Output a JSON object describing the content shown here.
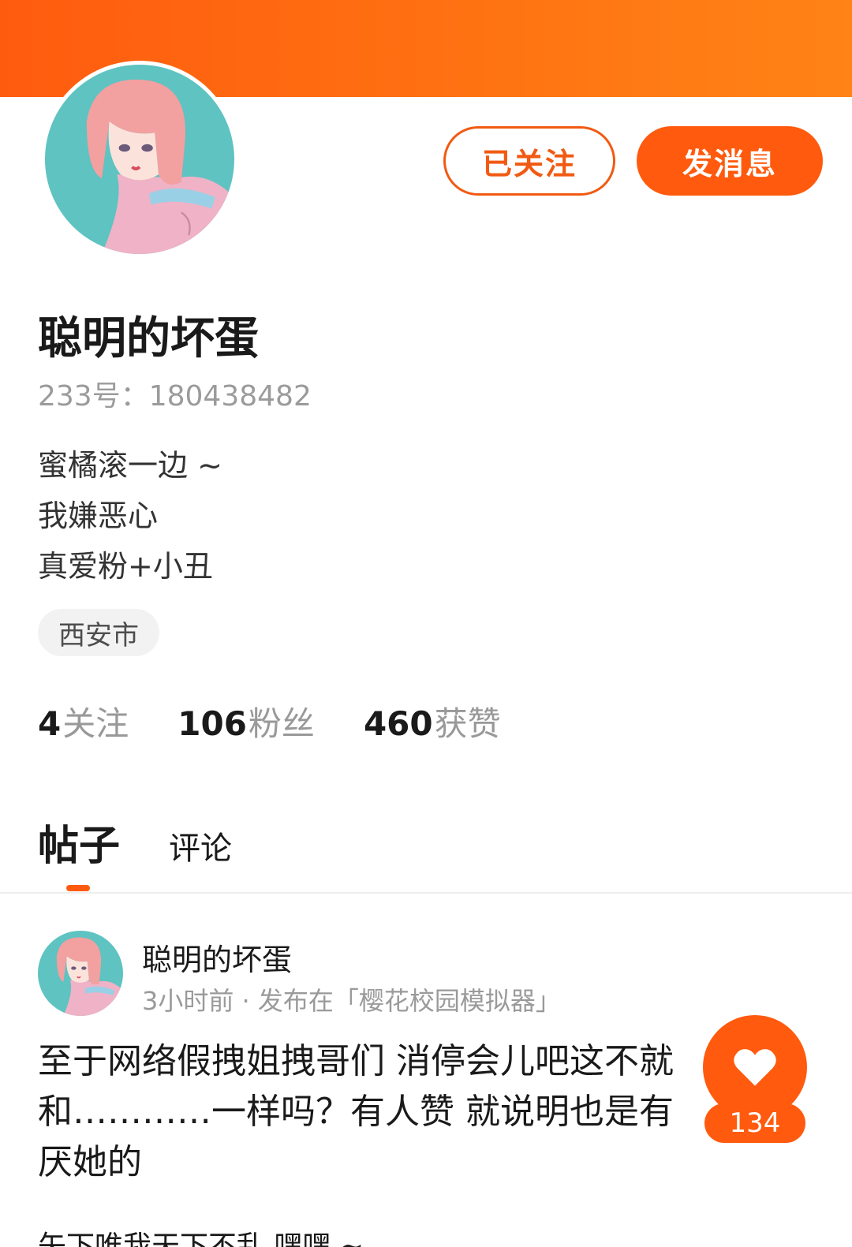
{
  "profile": {
    "buttons": {
      "follow_label": "已关注",
      "message_label": "发消息"
    },
    "name": "聪明的坏蛋",
    "uid": "233号：180438482",
    "bio": [
      "蜜橘滚一边 ~",
      "我嫌恶心",
      "真爱粉+小丑"
    ],
    "location": "西安市",
    "stats": [
      {
        "num": "4",
        "label": "关注"
      },
      {
        "num": "106",
        "label": "粉丝"
      },
      {
        "num": "460",
        "label": "获赞"
      }
    ]
  },
  "tabs": [
    {
      "label": "帖子",
      "active": true
    },
    {
      "label": "评论",
      "active": false
    }
  ],
  "post": {
    "author": "聪明的坏蛋",
    "meta": "3小时前 · 发布在「樱花校园模拟器」",
    "body_lines": [
      "至于网络假拽姐拽哥们 消停会儿吧这不就",
      "和…………一样吗？有人赞 就说明也是有",
      "厌她的"
    ],
    "next_line": "矢下唯我天下不乱 嘿嘿 ~",
    "likes": "134",
    "like_icon": "heart-icon"
  },
  "colors": {
    "accent": "#ff5a0d",
    "banner_start": "#ff5b0f",
    "banner_end": "#ff8316",
    "avatar_bg": "#5ec3c1",
    "hair": "#f2a0a0"
  }
}
